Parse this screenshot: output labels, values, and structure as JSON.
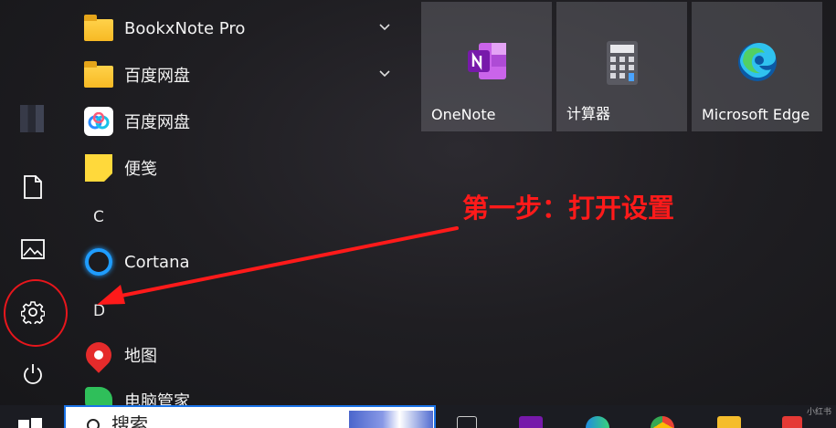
{
  "colors": {
    "accent_red": "#ff1a1a",
    "highlight_circle": "#e8161c",
    "tile_bg": "#6e6e76",
    "search_border": "#1a73e8"
  },
  "rail": {
    "items": [
      {
        "name": "documents",
        "icon": "document-icon"
      },
      {
        "name": "pictures",
        "icon": "picture-icon"
      },
      {
        "name": "settings",
        "icon": "gear-icon"
      },
      {
        "name": "power",
        "icon": "power-icon"
      }
    ]
  },
  "app_list": {
    "items": [
      {
        "label": "BookxNote Pro",
        "icon": "folder-icon",
        "expandable": true
      },
      {
        "label": "百度网盘",
        "icon": "folder-icon",
        "expandable": true
      },
      {
        "label": "百度网盘",
        "icon": "baidu-netdisk-icon",
        "expandable": false
      },
      {
        "label": "便笺",
        "icon": "sticky-notes-icon",
        "expandable": false
      }
    ],
    "section_c": "C",
    "cortana": "Cortana",
    "section_d": "D",
    "maps": "地图",
    "pc_manager": "电脑管家"
  },
  "tiles": [
    {
      "label": "OneNote",
      "icon": "onenote-icon"
    },
    {
      "label": "计算器",
      "icon": "calculator-icon"
    },
    {
      "label": "Microsoft Edge",
      "icon": "edge-icon"
    }
  ],
  "annotation": {
    "text": "第一步：打开设置"
  },
  "taskbar": {
    "search_text": "搜索",
    "icons": [
      "start-icon",
      "search-icon",
      "task-view-icon",
      "onenote-icon",
      "edge-icon",
      "chrome-icon",
      "file-explorer-icon",
      "security-icon"
    ]
  },
  "watermark": "小红书"
}
